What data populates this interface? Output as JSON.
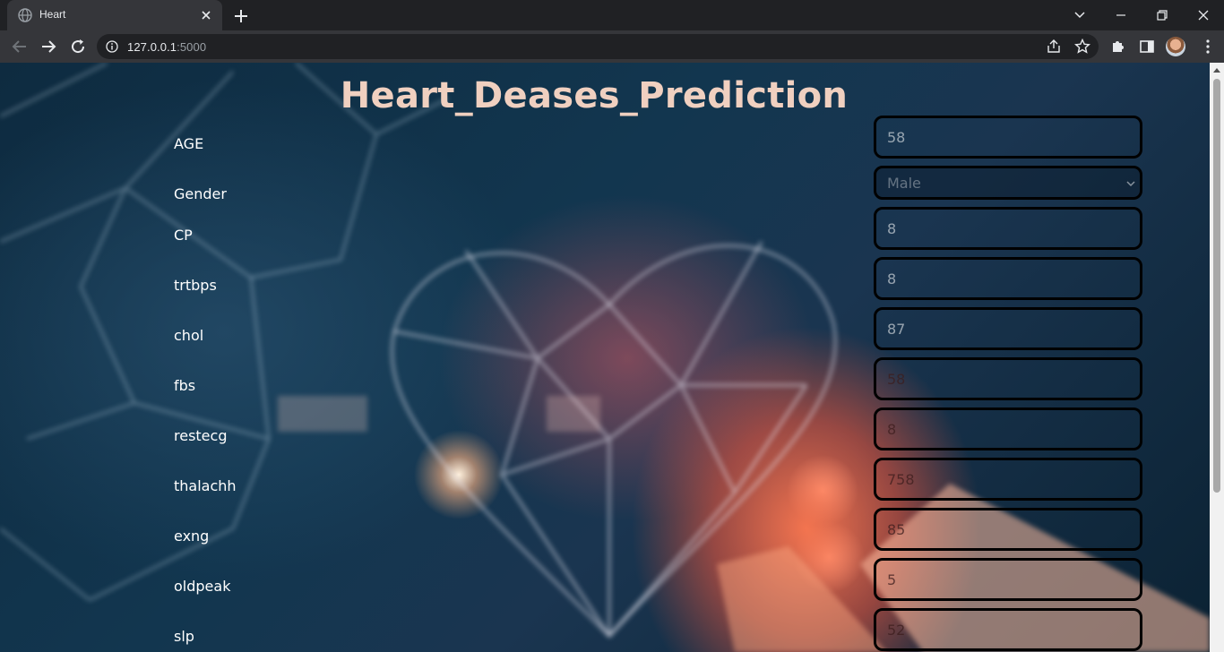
{
  "browser": {
    "tab_title": "Heart",
    "url_host": "127.0.0.1",
    "url_port": ":5000"
  },
  "page": {
    "title": "Heart_Deases_Prediction",
    "fields": [
      {
        "label": "AGE",
        "value": "58"
      },
      {
        "label": "Gender",
        "value": "Male"
      },
      {
        "label": "CP",
        "value": "8"
      },
      {
        "label": "trtbps",
        "value": "8"
      },
      {
        "label": "chol",
        "value": "87"
      },
      {
        "label": "fbs",
        "value": "58"
      },
      {
        "label": "restecg",
        "value": "8"
      },
      {
        "label": "thalachh",
        "value": "758"
      },
      {
        "label": "exng",
        "value": "85"
      },
      {
        "label": "oldpeak",
        "value": "5"
      },
      {
        "label": "slp",
        "value": "52"
      }
    ],
    "gender_options": [
      "Male"
    ]
  },
  "colors": {
    "title": "#f0d0c0",
    "label": "#ffffff",
    "chrome_dark": "#202124",
    "chrome_toolbar": "#35363a"
  }
}
